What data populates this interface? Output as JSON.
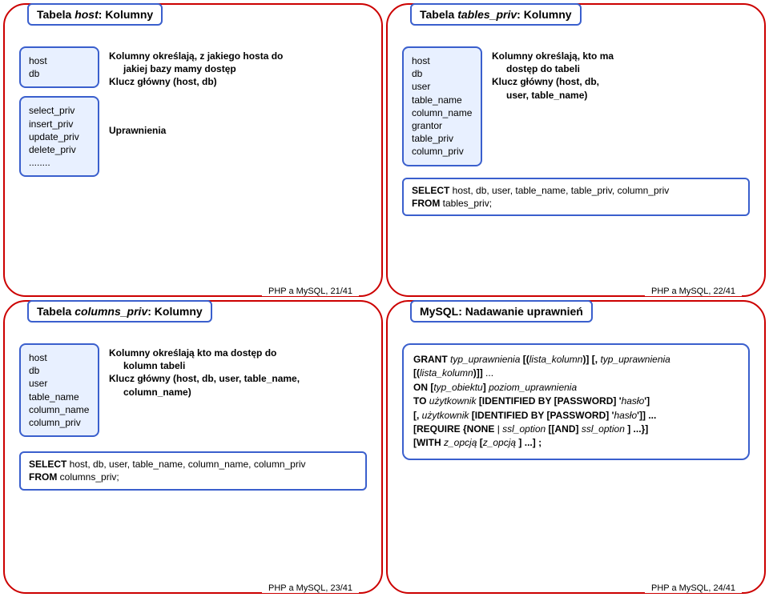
{
  "s1": {
    "title_prefix": "Tabela ",
    "title_em": "host",
    "title_suffix": ": Kolumny",
    "list1": [
      "host",
      "db"
    ],
    "list2": [
      "select_priv",
      "insert_priv",
      "update_priv",
      "delete_priv",
      "........"
    ],
    "desc_l1": "Kolumny określają, z jakiego hosta do",
    "desc_l2": "jakiej bazy mamy dostęp",
    "desc_l3": "Klucz główny (host, db)",
    "desc_l4": "Uprawnienia",
    "footer": "PHP a MySQL, 21/41"
  },
  "s2": {
    "title_prefix": "Tabela ",
    "title_em": "tables_priv",
    "title_suffix": ": Kolumny",
    "list": [
      "host",
      "db",
      "user",
      "table_name",
      "column_name",
      "grantor",
      "table_priv",
      "column_priv"
    ],
    "desc_l1": "Kolumny określają, kto ma",
    "desc_l2": "dostęp do tabeli",
    "desc_l3": "Klucz główny (host, db,",
    "desc_l4": "user, table_name)",
    "sql_l1a": "SELECT",
    "sql_l1b": " host, db, user, table_name, table_priv, column_priv",
    "sql_l2a": "FROM",
    "sql_l2b": " tables_priv;",
    "footer": "PHP a MySQL, 22/41"
  },
  "s3": {
    "title_prefix": "Tabela ",
    "title_em": "columns_priv",
    "title_suffix": ": Kolumny",
    "list": [
      "host",
      "db",
      "user",
      "table_name",
      "column_name",
      "column_priv"
    ],
    "desc_l1": "Kolumny określają kto ma dostęp do",
    "desc_l2": "kolumn tabeli",
    "desc_l3": "Klucz główny (host, db, user, table_name,",
    "desc_l4": "column_name)",
    "sql_l1a": "SELECT",
    "sql_l1b": " host, db, user, table_name, column_name, column_priv",
    "sql_l2a": "FROM",
    "sql_l2b": " columns_priv;",
    "footer": "PHP a MySQL, 23/41"
  },
  "s4": {
    "title": "MySQL: Nadawanie uprawnień",
    "g": {
      "grant": "GRANT ",
      "typ_upr": "typ_uprawnienia ",
      "lbr": "[(",
      "lista_kolumn": "lista_kolumn",
      "rbr": ")] [, ",
      "lbr2": "[(",
      "rbr2": ")]] ",
      "dots": "...",
      "on": "ON ",
      "lbr3": "[",
      "typ_obj": "typ_obiektu",
      "rbr3": "] ",
      "poziom": "poziom_uprawnienia",
      "to": "TO ",
      "uzytkownik": "użytkownik ",
      "ident": "[IDENTIFIED BY [PASSWORD] '",
      "haslo": "hasło",
      "close1": "']",
      "comma_u": "[, ",
      "close2": "']] ...",
      "req1": "[REQUIRE {NONE ",
      "pipe": "| ",
      "ssl": "ssl_option ",
      "and": "[[AND] ",
      "close3": "] ...}]",
      "with": "[WITH ",
      "zopc": "z_opcją ",
      "lbr4": "[",
      "close4": "] ...] ",
      "semi": ";"
    },
    "footer": "PHP a MySQL, 24/41"
  }
}
